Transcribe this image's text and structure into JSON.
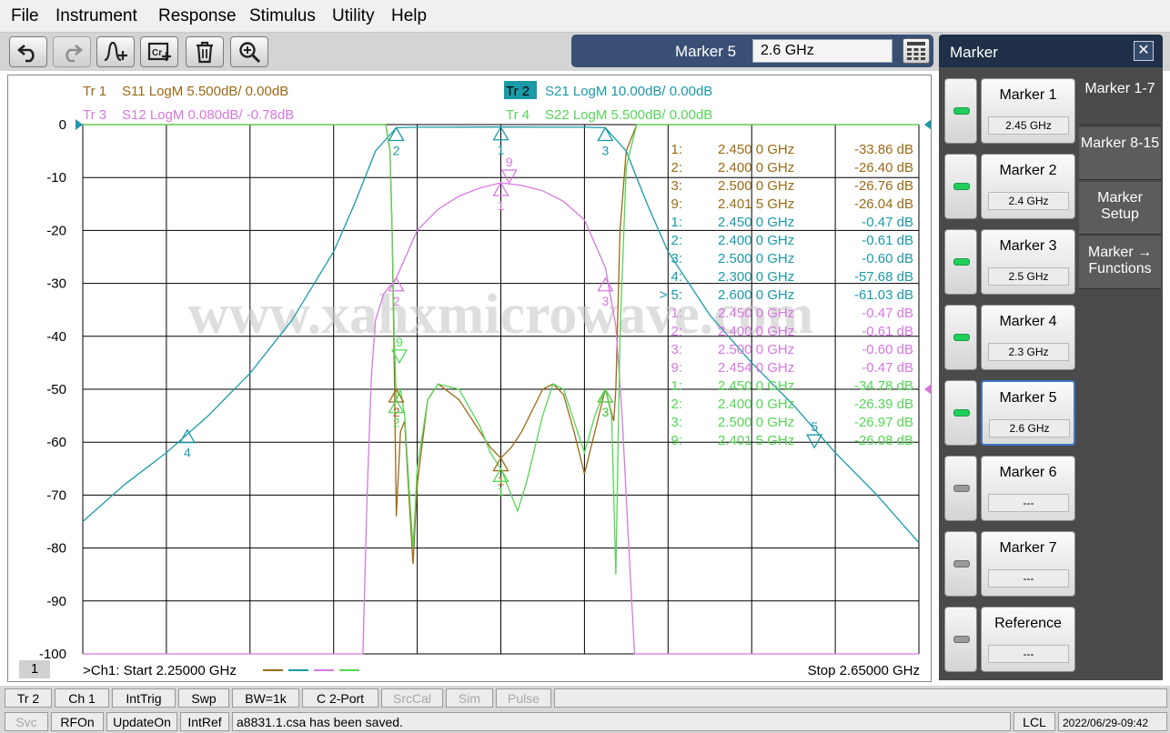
{
  "menu": [
    "File",
    "Instrument",
    "Response",
    "Stimulus",
    "Utility",
    "Help"
  ],
  "toolbar": {
    "icons": [
      "undo-icon",
      "redo-icon",
      "add-marker-icon",
      "copy-data-icon",
      "trash-icon",
      "zoom-in-icon"
    ],
    "entry_label": "Marker 5",
    "entry_value": "2.6 GHz",
    "keypad_icon": "keypad-icon"
  },
  "traces": [
    {
      "name": "Tr  1",
      "desc": "S11 LogM 5.500dB/  0.00dB",
      "color": "#9b6a14",
      "active": false
    },
    {
      "name": "Tr  2",
      "desc": "S21 LogM 10.00dB/  0.00dB",
      "color": "#1a9aa8",
      "active": true
    },
    {
      "name": "Tr  3",
      "desc": "S12 LogM 0.080dB/  -0.78dB",
      "color": "#d678df",
      "active": false
    },
    {
      "name": "Tr  4",
      "desc": "S22 LogM 5.500dB/  0.00dB",
      "color": "#55d655",
      "active": false
    }
  ],
  "marker_table": [
    {
      "id": "1:",
      "freq": "2.450 0 GHz",
      "value": "-33.86 dB",
      "color": "#9b6a14"
    },
    {
      "id": "2:",
      "freq": "2.400 0 GHz",
      "value": "-26.40 dB",
      "color": "#9b6a14"
    },
    {
      "id": "3:",
      "freq": "2.500 0 GHz",
      "value": "-26.76 dB",
      "color": "#9b6a14"
    },
    {
      "id": "9:",
      "freq": "2.401 5 GHz",
      "value": "-26.04 dB",
      "color": "#9b6a14"
    },
    {
      "id": "1:",
      "freq": "2.450 0 GHz",
      "value": "-0.47 dB",
      "color": "#1a9aa8"
    },
    {
      "id": "2:",
      "freq": "2.400 0 GHz",
      "value": "-0.61 dB",
      "color": "#1a9aa8"
    },
    {
      "id": "3:",
      "freq": "2.500 0 GHz",
      "value": "-0.60 dB",
      "color": "#1a9aa8"
    },
    {
      "id": "4:",
      "freq": "2.300 0 GHz",
      "value": "-57.68 dB",
      "color": "#1a9aa8"
    },
    {
      "id": "> 5:",
      "freq": "2.600 0 GHz",
      "value": "-61.03 dB",
      "color": "#1a9aa8"
    },
    {
      "id": "1:",
      "freq": "2.450 0 GHz",
      "value": "-0.47 dB",
      "color": "#d678df"
    },
    {
      "id": "2:",
      "freq": "2.400 0 GHz",
      "value": "-0.61 dB",
      "color": "#d678df"
    },
    {
      "id": "3:",
      "freq": "2.500 0 GHz",
      "value": "-0.60 dB",
      "color": "#d678df"
    },
    {
      "id": "9:",
      "freq": "2.454 0 GHz",
      "value": "-0.47 dB",
      "color": "#d678df"
    },
    {
      "id": "1:",
      "freq": "2.450 0 GHz",
      "value": "-34.78 dB",
      "color": "#55d655"
    },
    {
      "id": "2:",
      "freq": "2.400 0 GHz",
      "value": "-26.39 dB",
      "color": "#55d655"
    },
    {
      "id": "3:",
      "freq": "2.500 0 GHz",
      "value": "-26.97 dB",
      "color": "#55d655"
    },
    {
      "id": "9:",
      "freq": "2.401 5 GHz",
      "value": "-26.08 dB",
      "color": "#55d655"
    }
  ],
  "watermark": "www.xahxmicrowave.com",
  "chart": {
    "channel_number": "1",
    "start_label": ">Ch1:  Start   2.25000 GHz",
    "stop_label": "Stop  2.65000 GHz"
  },
  "chart_data": {
    "type": "line",
    "title": "",
    "xlabel": "",
    "ylabel": "",
    "xlim": [
      2.25,
      2.65
    ],
    "ylim": [
      -100,
      0
    ],
    "yticks": [
      0,
      -10,
      -20,
      -30,
      -40,
      -50,
      -60,
      -70,
      -80,
      -90,
      -100
    ],
    "grid": true,
    "series": [
      {
        "name": "S11",
        "color": "#9b6a14",
        "x": [
          2.25,
          2.395,
          2.397,
          2.398,
          2.399,
          2.4,
          2.402,
          2.404,
          2.406,
          2.408,
          2.41,
          2.415,
          2.42,
          2.43,
          2.44,
          2.445,
          2.45,
          2.455,
          2.46,
          2.47,
          2.475,
          2.48,
          2.485,
          2.49,
          2.495,
          2.5,
          2.502,
          2.504,
          2.505,
          2.507,
          2.51,
          2.515,
          2.52,
          2.65
        ],
        "y": [
          0,
          0,
          -5,
          -20,
          -45,
          -74,
          -58,
          -56,
          -70,
          -83,
          -68,
          -52,
          -49,
          -52,
          -58,
          -61,
          -63,
          -61,
          -58,
          -50,
          -49,
          -51,
          -58,
          -66,
          -58,
          -50,
          -53,
          -56,
          -50,
          -20,
          -5,
          0,
          0,
          0
        ]
      },
      {
        "name": "S21",
        "color": "#1a9aa8",
        "x": [
          2.25,
          2.27,
          2.29,
          2.31,
          2.33,
          2.35,
          2.37,
          2.38,
          2.39,
          2.4,
          2.41,
          2.42,
          2.45,
          2.48,
          2.49,
          2.5,
          2.51,
          2.52,
          2.53,
          2.55,
          2.57,
          2.59,
          2.61,
          2.63,
          2.65
        ],
        "y": [
          -75,
          -68,
          -62,
          -55,
          -47,
          -37,
          -24,
          -15,
          -5,
          -0.6,
          -0.5,
          -0.5,
          -0.47,
          -0.5,
          -0.5,
          -0.6,
          -5,
          -15,
          -24,
          -36,
          -45,
          -53,
          -62,
          -70,
          -79
        ]
      },
      {
        "name": "S12",
        "color": "#d678df",
        "x": [
          2.25,
          2.384,
          2.386,
          2.388,
          2.39,
          2.394,
          2.4,
          2.41,
          2.42,
          2.43,
          2.44,
          2.45,
          2.46,
          2.47,
          2.48,
          2.49,
          2.5,
          2.505,
          2.508,
          2.511,
          2.514,
          2.65
        ],
        "y": [
          -100,
          -100,
          -70,
          -48,
          -37,
          -32,
          -29,
          -20,
          -16,
          -13.5,
          -12,
          -11,
          -11.5,
          -12.5,
          -14.5,
          -18,
          -27,
          -38,
          -55,
          -78,
          -100,
          -100
        ]
      },
      {
        "name": "S22",
        "color": "#55d655",
        "x": [
          2.25,
          2.395,
          2.397,
          2.398,
          2.399,
          2.4,
          2.402,
          2.404,
          2.406,
          2.408,
          2.41,
          2.415,
          2.42,
          2.43,
          2.44,
          2.445,
          2.45,
          2.455,
          2.458,
          2.462,
          2.47,
          2.475,
          2.48,
          2.485,
          2.49,
          2.495,
          2.5,
          2.503,
          2.505,
          2.507,
          2.51,
          2.515,
          2.52,
          2.65
        ],
        "y": [
          0,
          0,
          -5,
          -20,
          -40,
          -52,
          -50,
          -55,
          -68,
          -80,
          -65,
          -52,
          -49,
          -50,
          -57,
          -62,
          -65,
          -70,
          -73,
          -68,
          -55,
          -49,
          -50,
          -56,
          -62,
          -55,
          -50,
          -55,
          -85,
          -40,
          -8,
          0,
          0,
          0
        ]
      }
    ],
    "markers": [
      {
        "trace": "S11",
        "label": "2",
        "x": 2.4,
        "y": -50
      },
      {
        "trace": "S11",
        "label": "3",
        "x": 2.5,
        "y": -50
      },
      {
        "trace": "S11",
        "label": "1",
        "x": 2.45,
        "y": -63
      },
      {
        "trace": "S21",
        "label": "2",
        "x": 2.4,
        "y": -0.6
      },
      {
        "trace": "S21",
        "label": "1",
        "x": 2.45,
        "y": -0.47
      },
      {
        "trace": "S21",
        "label": "3",
        "x": 2.5,
        "y": -0.6
      },
      {
        "trace": "S21",
        "label": "4",
        "x": 2.3,
        "y": -57.68
      },
      {
        "trace": "S21",
        "label": "5",
        "x": 2.6,
        "y": -61.03
      },
      {
        "trace": "S12",
        "label": "2",
        "x": 2.4,
        "y": -29
      },
      {
        "trace": "S12",
        "label": "3",
        "x": 2.5,
        "y": -29
      },
      {
        "trace": "S12",
        "label": "1",
        "x": 2.45,
        "y": -11
      },
      {
        "trace": "S12",
        "label": "9",
        "x": 2.454,
        "y": -11
      },
      {
        "trace": "S22",
        "label": "2",
        "x": 2.4,
        "y": -52
      },
      {
        "trace": "S22",
        "label": "3",
        "x": 2.5,
        "y": -50
      },
      {
        "trace": "S22",
        "label": "1",
        "x": 2.45,
        "y": -65
      },
      {
        "trace": "S22",
        "label": "9",
        "x": 2.4015,
        "y": -45
      }
    ]
  },
  "marker_panel": {
    "title": "Marker",
    "close_icon": "close-icon",
    "softkeys": [
      {
        "label": "Marker 1",
        "value": "2.45 GHz",
        "led": true,
        "active": false
      },
      {
        "label": "Marker 2",
        "value": "2.4 GHz",
        "led": true,
        "active": false
      },
      {
        "label": "Marker 3",
        "value": "2.5 GHz",
        "led": true,
        "active": false
      },
      {
        "label": "Marker 4",
        "value": "2.3 GHz",
        "led": true,
        "active": false
      },
      {
        "label": "Marker 5",
        "value": "2.6 GHz",
        "led": true,
        "active": true
      },
      {
        "label": "Marker 6",
        "value": "---",
        "led": false,
        "active": false
      },
      {
        "label": "Marker 7",
        "value": "---",
        "led": false,
        "active": false
      },
      {
        "label": "Reference",
        "value": "---",
        "led": false,
        "active": false
      }
    ],
    "tabs": [
      "Marker 1-7",
      "Marker 8-15",
      "Marker Setup",
      "Marker → Functions"
    ]
  },
  "status_row1": [
    "Tr 2",
    "Ch 1",
    "IntTrig",
    "Swp",
    "BW=1k",
    "C  2-Port",
    "SrcCal",
    "Sim",
    "Pulse"
  ],
  "status_row1_disabled": [
    "SrcCal",
    "Sim",
    "Pulse"
  ],
  "status_row2": {
    "items": [
      "Svc",
      "RFOn",
      "UpdateOn",
      "IntRef"
    ],
    "disabled": [
      "Svc"
    ],
    "message": "a8831.1.csa has been saved.",
    "lcl": "LCL",
    "datetime": "2022/06/29-09:42"
  }
}
